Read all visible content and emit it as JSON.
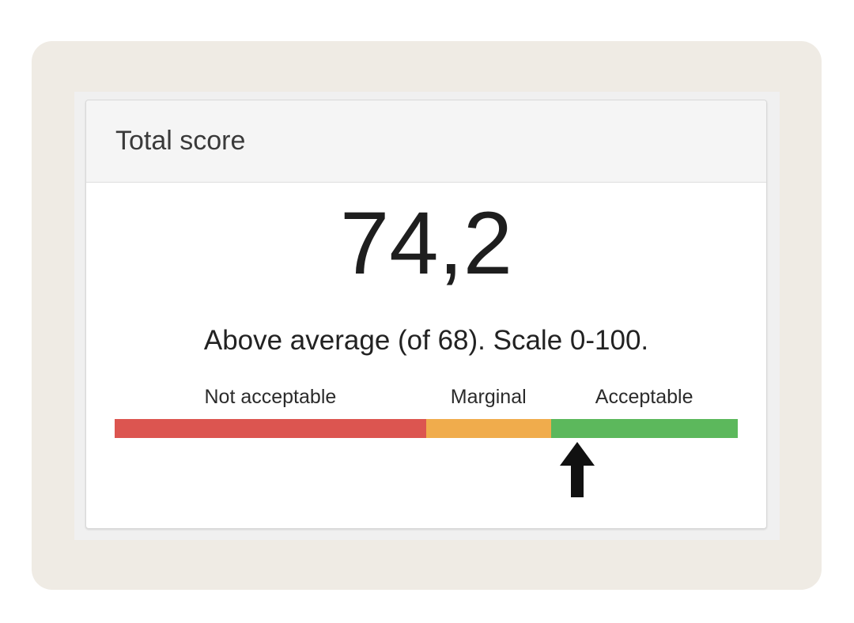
{
  "card": {
    "title": "Total score"
  },
  "score": {
    "value": "74,2",
    "numeric": 74.2,
    "description": "Above average (of 68). Scale 0-100."
  },
  "scale": {
    "min": 0,
    "max": 100,
    "segments": [
      {
        "label": "Not acceptable",
        "from": 0,
        "to": 50,
        "color": "#dc5550"
      },
      {
        "label": "Marginal",
        "from": 50,
        "to": 70,
        "color": "#f0ac4c"
      },
      {
        "label": "Acceptable",
        "from": 70,
        "to": 100,
        "color": "#5cb85c"
      }
    ],
    "marker_icon": "arrow-up-icon"
  },
  "colors": {
    "outer_background": "#efebe4",
    "card_header": "#f5f5f5",
    "marker": "#111111"
  }
}
